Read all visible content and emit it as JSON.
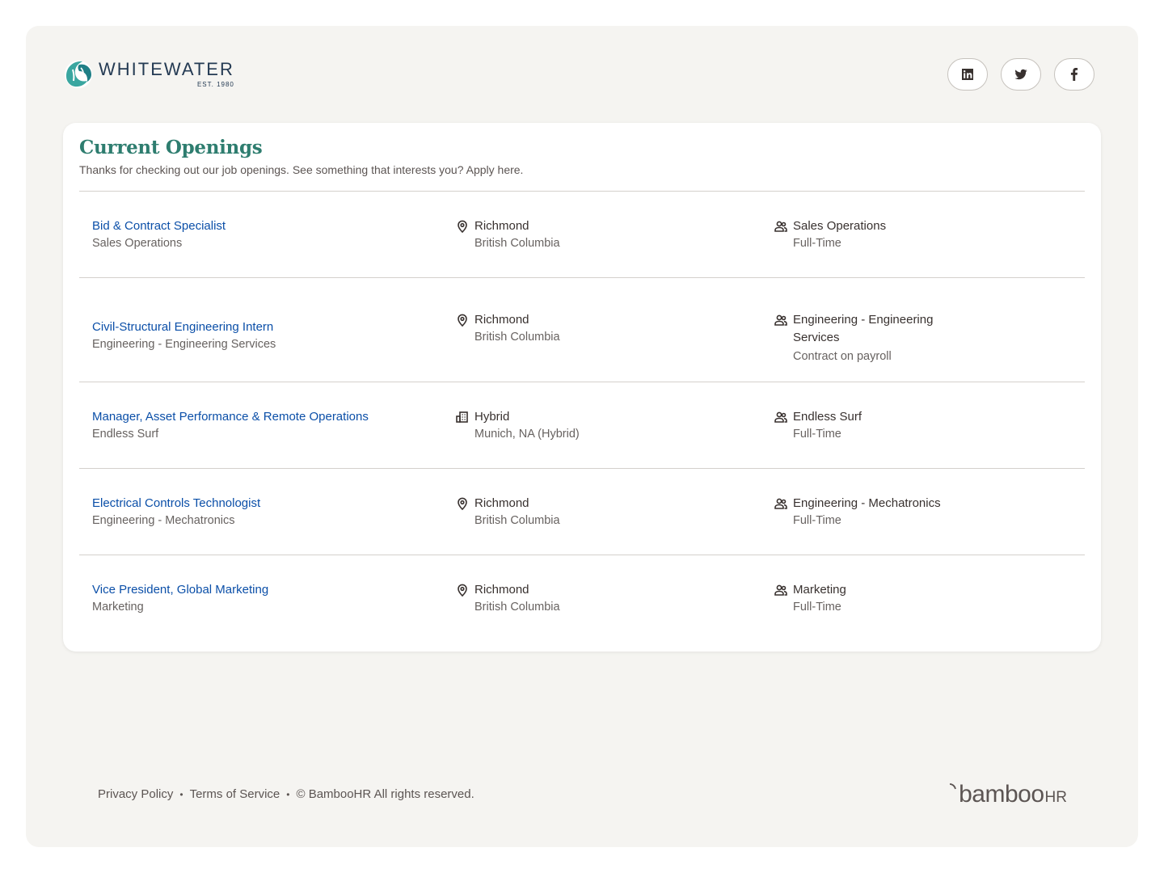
{
  "brand": {
    "name": "WHITEWATER",
    "est": "EST. 1980"
  },
  "socials": [
    {
      "icon": "linkedin-icon"
    },
    {
      "icon": "twitter-icon"
    },
    {
      "icon": "facebook-icon"
    }
  ],
  "openings": {
    "title": "Current Openings",
    "subtitle": "Thanks for checking out our job openings. See something that interests you? Apply here.",
    "jobs": [
      {
        "title": "Bid & Contract Specialist",
        "department": "Sales Operations",
        "location_icon": "map-pin-icon",
        "location": "Richmond",
        "region": "British Columbia",
        "team": "Sales Operations",
        "type": "Full-Time"
      },
      {
        "title": "Civil-Structural Engineering Intern",
        "department": "Engineering - Engineering Services",
        "location_icon": "map-pin-icon",
        "location": "Richmond",
        "region": "British Columbia",
        "team": "Engineering - Engineering Services",
        "type": "Contract on payroll"
      },
      {
        "title": "Manager, Asset Performance & Remote Operations",
        "department": "Endless Surf",
        "location_icon": "building-icon",
        "location": "Hybrid",
        "region": "Munich, NA (Hybrid)",
        "team": "Endless Surf",
        "type": "Full-Time"
      },
      {
        "title": "Electrical Controls Technologist",
        "department": "Engineering - Mechatronics",
        "location_icon": "map-pin-icon",
        "location": "Richmond",
        "region": "British Columbia",
        "team": "Engineering - Mechatronics",
        "type": "Full-Time"
      },
      {
        "title": "Vice President, Global Marketing",
        "department": "Marketing",
        "location_icon": "map-pin-icon",
        "location": "Richmond",
        "region": "British Columbia",
        "team": "Marketing",
        "type": "Full-Time"
      }
    ]
  },
  "footer": {
    "privacy": "Privacy Policy",
    "terms": "Terms of Service",
    "copyright": "© BambooHR All rights reserved.",
    "separator": "•",
    "powered_by": "bamboo",
    "powered_by_suffix": "HR"
  },
  "colors": {
    "heading": "#2e7d6f",
    "link": "#0b4fa8",
    "background": "#f5f4f1",
    "card": "#ffffff"
  }
}
